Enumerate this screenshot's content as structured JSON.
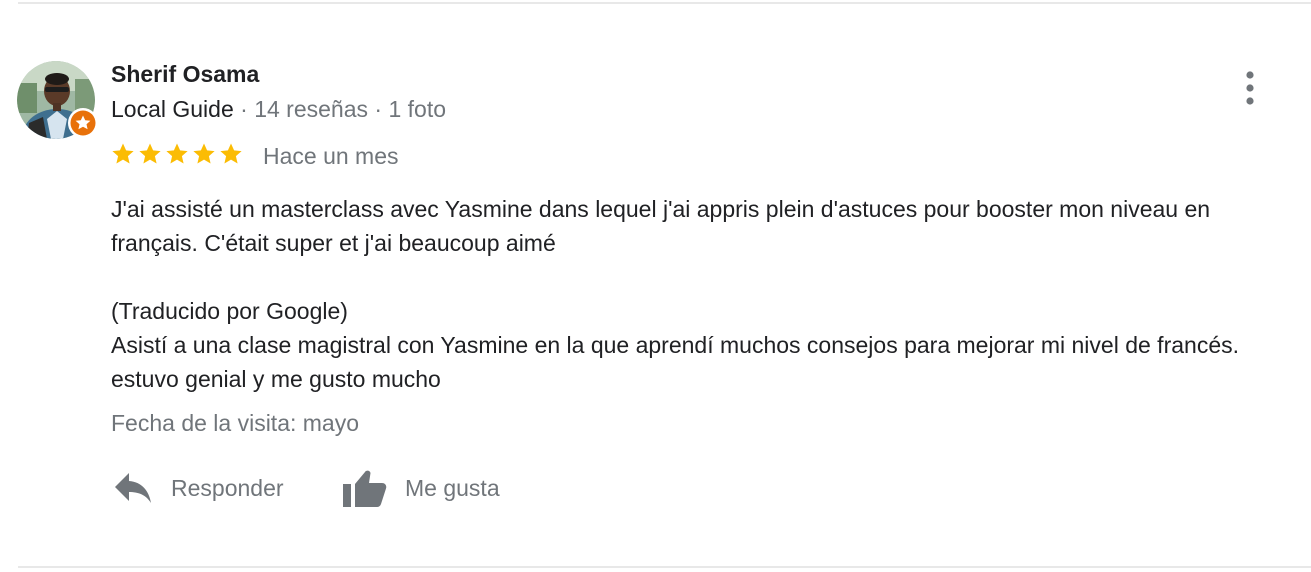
{
  "reviewer": {
    "name": "Sherif Osama",
    "guide_label": "Local Guide",
    "separator": " · ",
    "reviews_count": "14 reseñas",
    "photos_count": "1 foto",
    "avatar_icon": "profile-photo",
    "badge_icon": "local-guide-star-badge",
    "badge_color": "#e8710a"
  },
  "review": {
    "rating": 5,
    "max_rating": 5,
    "star_color": "#fbbc04",
    "time_ago": "Hace un mes",
    "original_text": "J'ai assisté un masterclass avec Yasmine dans lequel j'ai appris plein d'astuces pour booster mon niveau en français. C'était super et j'ai beaucoup aimé",
    "translated_note": "(Traducido por Google)",
    "translated_text": "Asistí a una clase magistral con Yasmine en la que aprendí muchos consejos para mejorar mi nivel de francés. estuvo genial y me gusto mucho",
    "visit_date": "Fecha de la visita: mayo"
  },
  "actions": {
    "reply_label": "Responder",
    "reply_icon": "reply-arrow-icon",
    "like_label": "Me gusta",
    "like_icon": "thumbs-up-icon",
    "more_icon": "more-vert-icon",
    "icon_color": "#70757a"
  }
}
